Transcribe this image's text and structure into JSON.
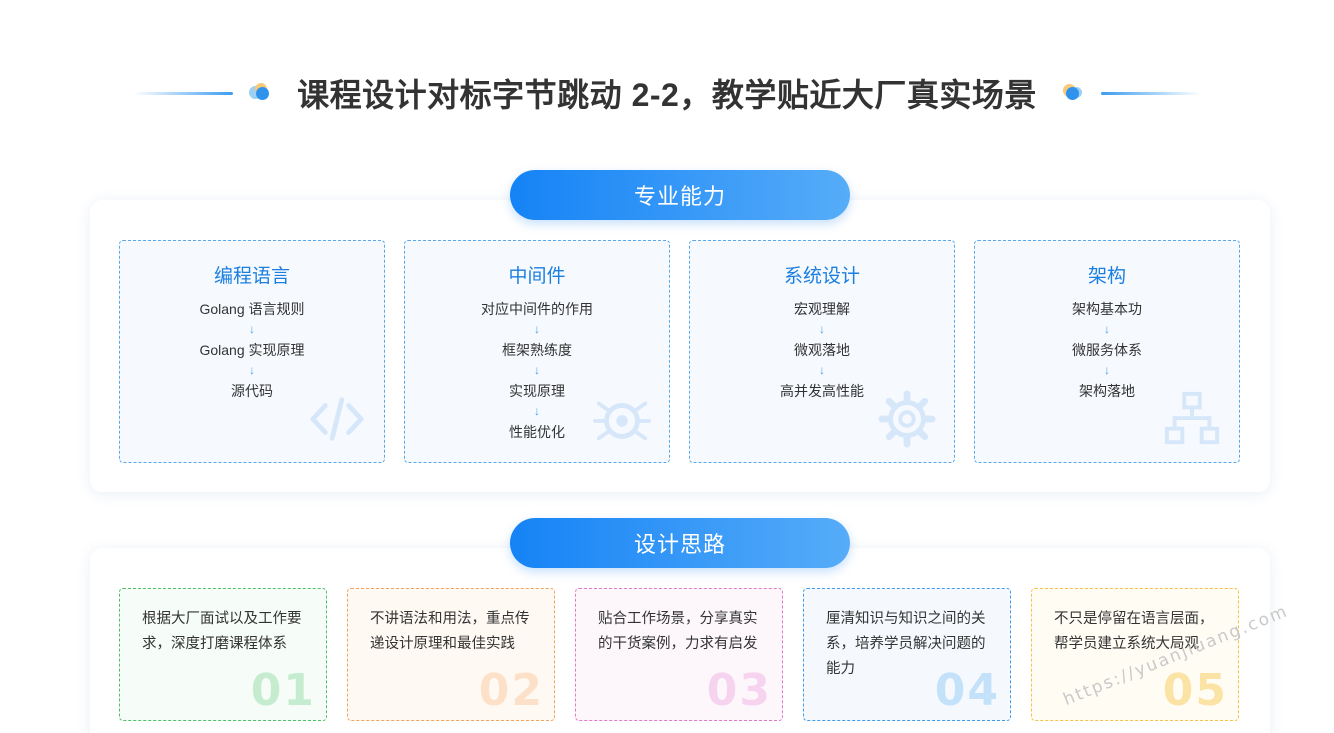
{
  "header": {
    "title": "课程设计对标字节跳动 2-2，教学贴近大厂真实场景"
  },
  "section_professional": {
    "label": "专业能力",
    "cards": [
      {
        "title": "编程语言",
        "items": [
          "Golang 语言规则",
          "Golang 实现原理",
          "源代码"
        ],
        "icon": "code-icon"
      },
      {
        "title": "中间件",
        "items": [
          "对应中间件的作用",
          "框架熟练度",
          "实现原理",
          "性能优化"
        ],
        "icon": "bug-icon"
      },
      {
        "title": "系统设计",
        "items": [
          "宏观理解",
          "微观落地",
          "高并发高性能"
        ],
        "icon": "gear-icon"
      },
      {
        "title": "架构",
        "items": [
          "架构基本功",
          "微服务体系",
          "架构落地"
        ],
        "icon": "hierarchy-icon"
      }
    ]
  },
  "section_design": {
    "label": "设计思路",
    "cards": [
      {
        "text": "根据大厂面试以及工作要求，深度打磨课程体系",
        "num": "01",
        "color": "#4cc06a"
      },
      {
        "text": "不讲语法和用法，重点传递设计原理和最佳实践",
        "num": "02",
        "color": "#f3a25a"
      },
      {
        "text": "贴合工作场景，分享真实的干货案例，力求有启发",
        "num": "03",
        "color": "#e07ac9"
      },
      {
        "text": "厘清知识与知识之间的关系，培养学员解决问题的能力",
        "num": "04",
        "color": "#3d9cf0"
      },
      {
        "text": "不只是停留在语言层面，帮学员建立系统大局观",
        "num": "05",
        "color": "#f7c04a"
      }
    ]
  },
  "watermark": "https://yuanjiuang.com",
  "colors": {
    "accent": "#1583f6",
    "card_border_blue": "#5aa9ec",
    "title_blue": "#1b7fe0"
  }
}
